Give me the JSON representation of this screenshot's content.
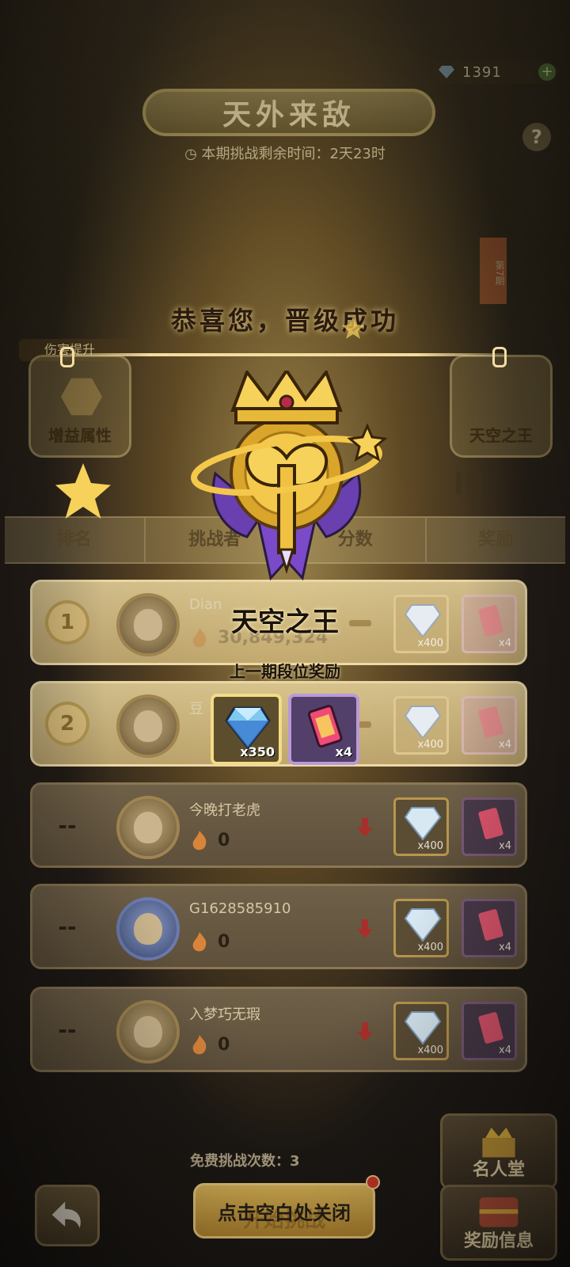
{
  "currency": {
    "gems": "1391",
    "gem_icon": "diamond-icon",
    "add_icon": "plus-icon"
  },
  "event": {
    "title": "天外来敌",
    "timer": "本期挑战剩余时间：2天23时",
    "help": "?",
    "season_badge": "第7期"
  },
  "popup": {
    "congrats": "恭喜您，晋级成功",
    "rank_name": "天空之王",
    "reward_caption": "上一期段位奖励",
    "rewards": [
      {
        "icon": "diamond-icon",
        "qty": "x350"
      },
      {
        "icon": "card-pack-icon",
        "qty": "x4"
      }
    ],
    "close_hint": "点击空白处关闭"
  },
  "panels": {
    "left_tag": "伤害提升",
    "left_label": "增益属性",
    "right_label": "天空之王"
  },
  "table": {
    "headers": [
      "排名",
      "挑战者",
      "分数",
      "奖励"
    ],
    "rows": [
      {
        "rank": "1",
        "name": "Dian",
        "score": "30,849,324",
        "trend": "same",
        "reward1": "x400",
        "reward2": "x4"
      },
      {
        "rank": "2",
        "name": "豆",
        "score": "",
        "trend": "same",
        "reward1": "x400",
        "reward2": "x4"
      },
      {
        "rank": "--",
        "name": "今晚打老虎",
        "score": "0",
        "trend": "down",
        "reward1": "x400",
        "reward2": "x4"
      },
      {
        "rank": "--",
        "name": "G1628585910",
        "score": "0",
        "trend": "down",
        "reward1": "x400",
        "reward2": "x4"
      },
      {
        "rank": "--",
        "name": "入梦巧无瑕",
        "score": "0",
        "trend": "down",
        "reward1": "x400",
        "reward2": "x4"
      }
    ]
  },
  "footer": {
    "free_challenges": "免费挑战次数：3",
    "start_label": "开始挑战",
    "hall_of_fame": "名人堂",
    "reward_info": "奖励信息"
  },
  "colors": {
    "accent_gold": "#f2dc86",
    "card_purple": "#b79ad8",
    "trend_down": "#c0392b"
  }
}
